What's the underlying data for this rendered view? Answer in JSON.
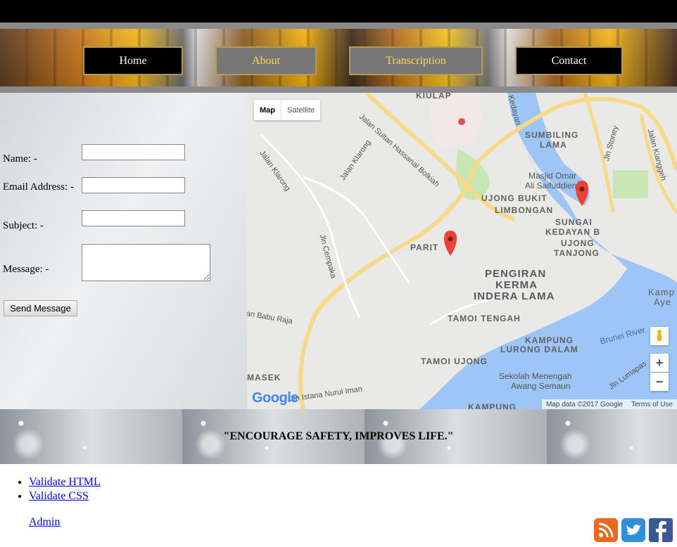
{
  "nav": {
    "items": [
      {
        "label": "Home"
      },
      {
        "label": "About"
      },
      {
        "label": "Transcription"
      },
      {
        "label": "Contact"
      }
    ]
  },
  "form": {
    "name_label": "Name: -",
    "email_label": "Email Address: -",
    "subject_label": "Subject: -",
    "message_label": "Message: -",
    "name_value": "",
    "email_value": "",
    "subject_value": "",
    "message_value": "",
    "send_label": "Send Message"
  },
  "map": {
    "toggle_map": "Map",
    "toggle_satellite": "Satellite",
    "labels": {
      "kiulap": "KIULAP",
      "jalan_sultan": "Jalan Sultan Hassanal Bolkiah",
      "jalan_klarong_1": "Jalan Klarong",
      "jalan_klarong_2": "Jalan Klarong",
      "kedayan": "Kedayan",
      "sumbiling": "SUMBILING",
      "lama": "LAMA",
      "jln_stoney": "Jln Stoney",
      "jalan_kianggeh": "Jalan Kianggeh",
      "masjid_omar_1": "Masjid Omar",
      "masjid_omar_2": "Ali Saifuddien",
      "ujong_bukit": "UJONG BUKIT",
      "limbongan": "LIMBONGAN",
      "sungai": "SUNGAI",
      "kedayan_b": "KEDAYAN B",
      "ujong": "UJONG",
      "tanjong": "TANJONG",
      "parit": "PARIT",
      "jln_cempaka": "Jln Cempaka",
      "pengiran": "PENGIRAN",
      "kerma": "KERMA",
      "indera_lama": "INDERA LAMA",
      "kamp": "Kamp",
      "aye": "Aye",
      "an_babu_raja": "an Babu Raja",
      "tamoi_tengah": "TAMOI TENGAH",
      "kampung": "KAMPUNG",
      "lurong_dalam": "LURONG DALAM",
      "brunei_river": "Brunei River",
      "tamoi_ujong": "TAMOI UJONG",
      "sekolah_1": "Sekolah Menengah",
      "sekolah_2": "Awang Semaun",
      "jln_lumapas": "Jln Lumapas",
      "masek": "MASEK",
      "jln_istana": "Jln Istana Nurul Iman",
      "kampung2": "KAMPUNG"
    },
    "google": "Google",
    "map_data": "Map data ©2017 Google",
    "terms": "Terms of Use",
    "zoom_in": "+",
    "zoom_out": "−"
  },
  "quote": "\"ENCOURAGE SAFETY, IMPROVES LIFE.\"",
  "footer": {
    "links": [
      {
        "label": "Validate HTML"
      },
      {
        "label": "Validate CSS"
      }
    ],
    "admin": "Admin"
  },
  "social": {
    "rss_color": "#e86a1a",
    "twitter_color": "#2f8fd8",
    "facebook_color": "#3b5998"
  }
}
